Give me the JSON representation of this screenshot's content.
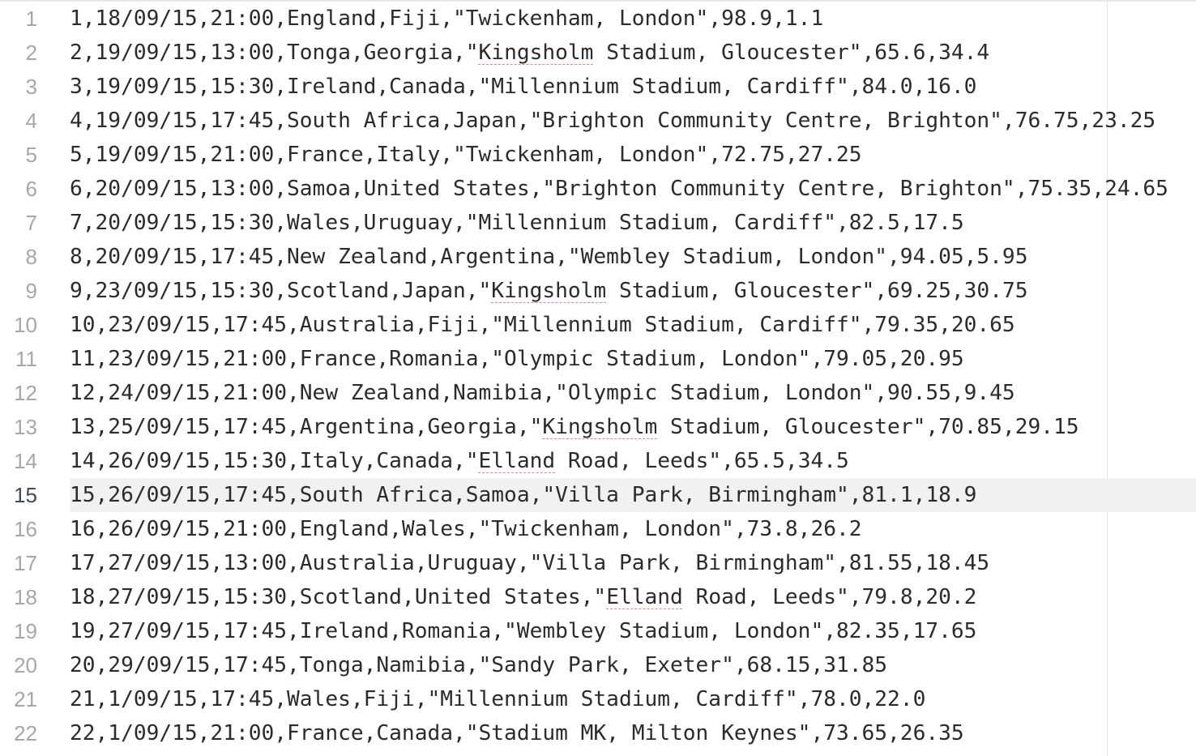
{
  "editor": {
    "current_line": 15,
    "lines": [
      {
        "num": "1",
        "text": "1,18/09/15,21:00,England,Fiji,\"Twickenham, London\",98.9,1.1"
      },
      {
        "num": "2",
        "pre": "2,19/09/15,13:00,Tonga,Georgia,\"",
        "flag": "Kingsholm",
        "post": " Stadium, Gloucester\",65.6,34.4"
      },
      {
        "num": "3",
        "text": "3,19/09/15,15:30,Ireland,Canada,\"Millennium Stadium, Cardiff\",84.0,16.0"
      },
      {
        "num": "4",
        "text": "4,19/09/15,17:45,South Africa,Japan,\"Brighton Community Centre, Brighton\",76.75,23.25"
      },
      {
        "num": "5",
        "text": "5,19/09/15,21:00,France,Italy,\"Twickenham, London\",72.75,27.25"
      },
      {
        "num": "6",
        "text": "6,20/09/15,13:00,Samoa,United States,\"Brighton Community Centre, Brighton\",75.35,24.65"
      },
      {
        "num": "7",
        "text": "7,20/09/15,15:30,Wales,Uruguay,\"Millennium Stadium, Cardiff\",82.5,17.5"
      },
      {
        "num": "8",
        "text": "8,20/09/15,17:45,New Zealand,Argentina,\"Wembley Stadium, London\",94.05,5.95"
      },
      {
        "num": "9",
        "pre": "9,23/09/15,15:30,Scotland,Japan,\"",
        "flag": "Kingsholm",
        "post": " Stadium, Gloucester\",69.25,30.75"
      },
      {
        "num": "10",
        "text": "10,23/09/15,17:45,Australia,Fiji,\"Millennium Stadium, Cardiff\",79.35,20.65"
      },
      {
        "num": "11",
        "text": "11,23/09/15,21:00,France,Romania,\"Olympic Stadium, London\",79.05,20.95"
      },
      {
        "num": "12",
        "text": "12,24/09/15,21:00,New Zealand,Namibia,\"Olympic Stadium, London\",90.55,9.45"
      },
      {
        "num": "13",
        "pre": "13,25/09/15,17:45,Argentina,Georgia,\"",
        "flag": "Kingsholm",
        "post": " Stadium, Gloucester\",70.85,29.15"
      },
      {
        "num": "14",
        "pre": "14,26/09/15,15:30,Italy,Canada,\"",
        "flag": "Elland",
        "post": " Road, Leeds\",65.5,34.5"
      },
      {
        "num": "15",
        "text": "15,26/09/15,17:45,South Africa,Samoa,\"Villa Park, Birmingham\",81.1,18.9"
      },
      {
        "num": "16",
        "text": "16,26/09/15,21:00,England,Wales,\"Twickenham, London\",73.8,26.2"
      },
      {
        "num": "17",
        "text": "17,27/09/15,13:00,Australia,Uruguay,\"Villa Park, Birmingham\",81.55,18.45"
      },
      {
        "num": "18",
        "pre": "18,27/09/15,15:30,Scotland,United States,\"",
        "flag": "Elland",
        "post": " Road, Leeds\",79.8,20.2"
      },
      {
        "num": "19",
        "text": "19,27/09/15,17:45,Ireland,Romania,\"Wembley Stadium, London\",82.35,17.65"
      },
      {
        "num": "20",
        "text": "20,29/09/15,17:45,Tonga,Namibia,\"Sandy Park, Exeter\",68.15,31.85"
      },
      {
        "num": "21",
        "text": "21,1/09/15,17:45,Wales,Fiji,\"Millennium Stadium, Cardiff\",78.0,22.0"
      },
      {
        "num": "22",
        "text": "22,1/09/15,21:00,France,Canada,\"Stadium MK, Milton Keynes\",73.65,26.35"
      }
    ]
  }
}
